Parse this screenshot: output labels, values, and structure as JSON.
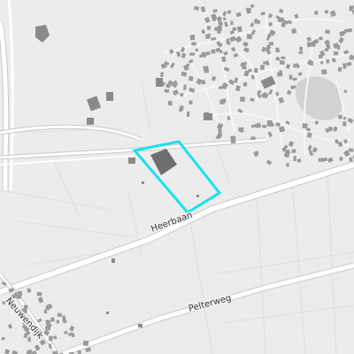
{
  "map": {
    "colors": {
      "background": "#ececec",
      "road_major": "#ffffff",
      "road_casing": "#c9c9c9",
      "road_minor": "#f7f7f7",
      "building": "#9a9a9a",
      "building_dark": "#6f6f6f",
      "water": "#d3d3d3",
      "highlight": "#18e1f0"
    },
    "labels": {
      "heerbaan": "Heerbaan",
      "pelterweg": "Pelterweg",
      "neuwendijk": "Neuwendijk"
    },
    "highlight_area": {
      "description_label": "",
      "outline_color": "#18e1f0"
    }
  }
}
